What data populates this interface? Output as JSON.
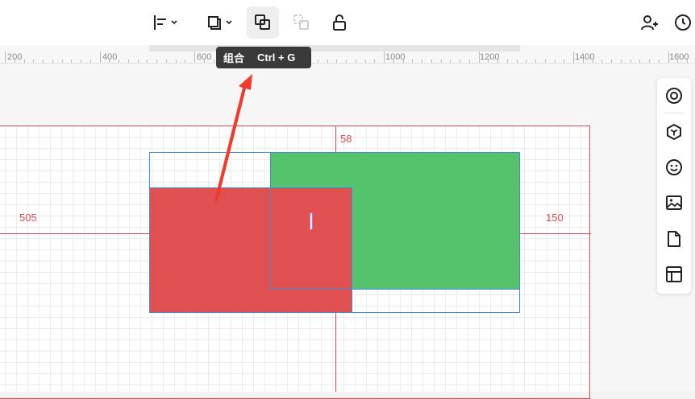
{
  "toolbar": {
    "align_button": "align-left-icon",
    "arrange_button": "layer-arrange-icon",
    "group_button": "group-icon",
    "ungroup_button": "ungroup-icon",
    "lock_button": "unlock-icon",
    "add_collaborator_button": "add-user-icon",
    "history_button": "history-icon"
  },
  "tooltip": {
    "title": "组合",
    "shortcut": "Ctrl + G"
  },
  "ruler": {
    "labels": [
      "200",
      "400",
      "600",
      "800",
      "1000",
      "1200",
      "1400",
      "1600"
    ]
  },
  "canvas": {
    "measure_top": "58",
    "measure_left": "505",
    "measure_right": "150",
    "shape_colors": {
      "green": "#54c36c",
      "red": "#e05050",
      "selection": "#3b8de0",
      "guide": "#e2484f"
    }
  },
  "side_panel": {
    "items": [
      "target-icon",
      "cube-icon",
      "emoji-icon",
      "image-icon",
      "file-icon",
      "layout-icon"
    ]
  }
}
